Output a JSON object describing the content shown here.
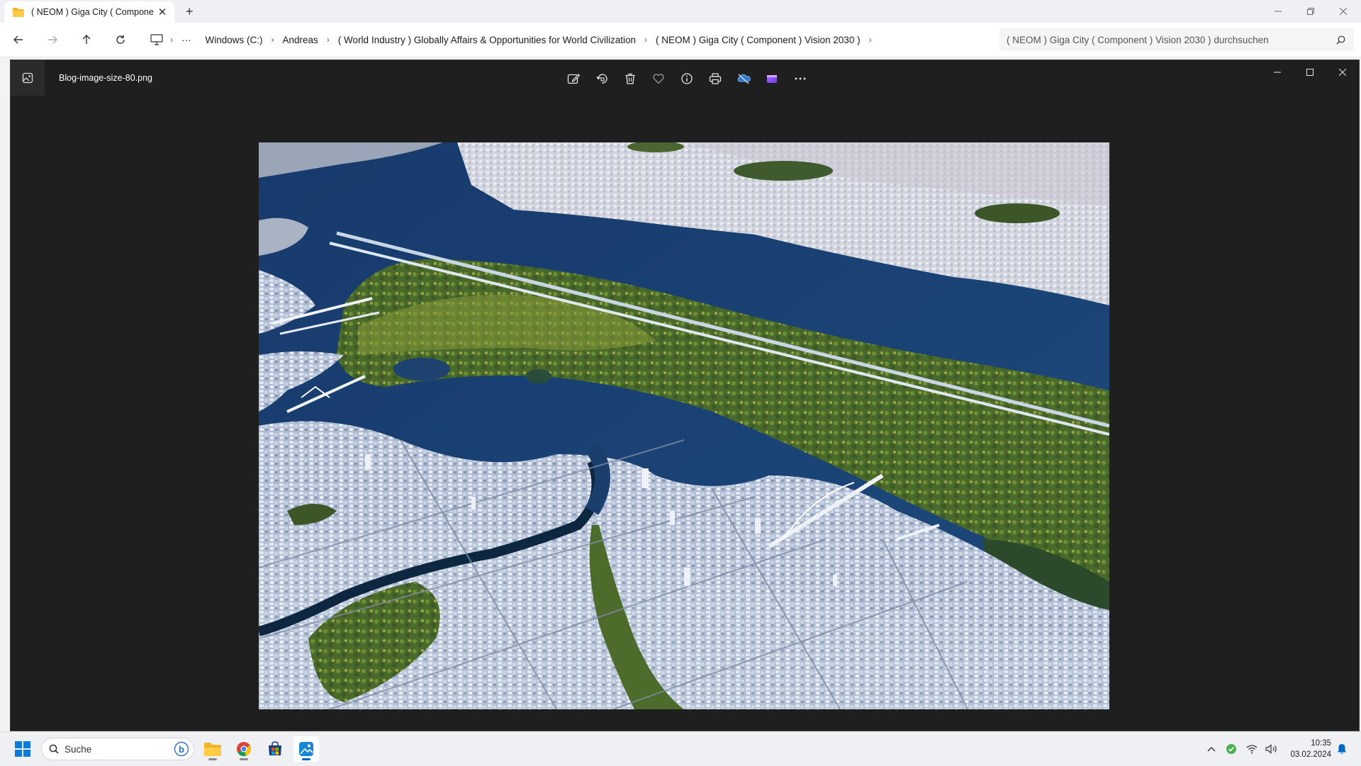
{
  "explorer": {
    "tab_title": "( NEOM ) Giga City ( Compone",
    "breadcrumbs": [
      "Windows (C:)",
      "Andreas",
      "( World Industry ) Globally Affairs & Opportunities for World Civilization",
      "( NEOM ) Giga City ( Component ) Vision 2030 )"
    ],
    "overflow_label": "···",
    "search_placeholder": "( NEOM ) Giga City ( Component ) Vision 2030 ) durchsuchen"
  },
  "viewer": {
    "file_name": "Blog-image-size-80.png",
    "toolbar_icons": [
      "edit-icon",
      "rotate-icon",
      "delete-icon",
      "favorite-icon",
      "info-icon",
      "print-icon",
      "onedrive-icon",
      "clipchamp-icon",
      "more-icon"
    ]
  },
  "photo": {
    "description_colors": {
      "water": "#1d3f6e",
      "park": "#4f6a2b",
      "city": "#b7c3d6"
    }
  },
  "taskbar": {
    "search_label": "Suche",
    "time": "10:35",
    "date": "03.02.2024",
    "accent": "#0067c0"
  }
}
